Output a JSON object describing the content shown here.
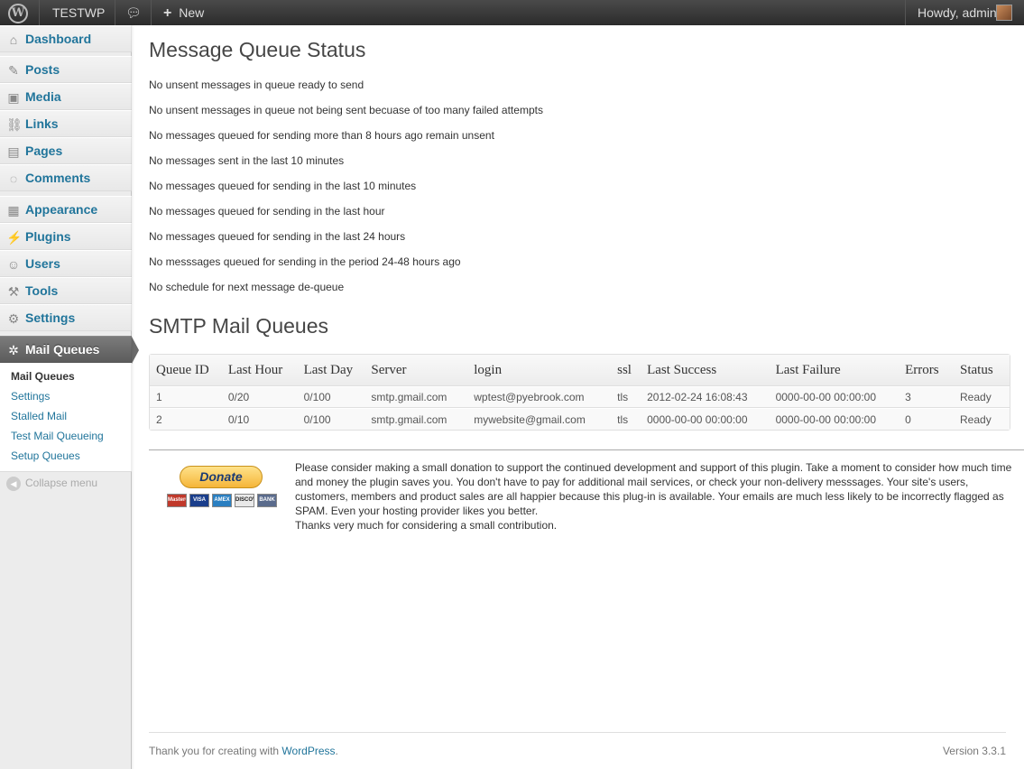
{
  "adminbar": {
    "site_name": "TESTWP",
    "new_label": "New",
    "howdy": "Howdy, admin"
  },
  "sidebar": {
    "items": [
      {
        "label": "Dashboard",
        "icon": "dashboard-icon",
        "glyph": "⌂"
      },
      {
        "label": "Posts",
        "icon": "pushpin-icon",
        "glyph": "✎"
      },
      {
        "label": "Media",
        "icon": "media-icon",
        "glyph": "▣"
      },
      {
        "label": "Links",
        "icon": "link-icon",
        "glyph": "⛓"
      },
      {
        "label": "Pages",
        "icon": "pages-icon",
        "glyph": "▤"
      },
      {
        "label": "Comments",
        "icon": "comment-bubble-icon",
        "glyph": "◌"
      },
      {
        "label": "Appearance",
        "icon": "appearance-icon",
        "glyph": "▦"
      },
      {
        "label": "Plugins",
        "icon": "plug-icon",
        "glyph": "⚡"
      },
      {
        "label": "Users",
        "icon": "users-icon",
        "glyph": "☺"
      },
      {
        "label": "Tools",
        "icon": "tools-icon",
        "glyph": "⚒"
      },
      {
        "label": "Settings",
        "icon": "settings-icon",
        "glyph": "⚙"
      },
      {
        "label": "Mail Queues",
        "icon": "gear-icon",
        "glyph": "✲"
      }
    ],
    "submenu": [
      "Mail Queues",
      "Settings",
      "Stalled Mail",
      "Test Mail Queueing",
      "Setup Queues"
    ],
    "collapse_label": "Collapse menu"
  },
  "main": {
    "status_title": "Message Queue Status",
    "status_lines": [
      "No unsent messages in queue ready to send",
      "No unsent messages in queue not being sent becuase of too many failed attempts",
      "No messages queued for sending more than 8 hours ago remain unsent",
      "No messages sent in the last 10 minutes",
      "No messages queued for sending in the last 10 minutes",
      "No messages queued for sending in the last hour",
      "No messages queued for sending in the last 24 hours",
      "No messsages queued for sending in the period 24-48 hours ago",
      "No schedule for next message de-queue"
    ],
    "queues_title": "SMTP Mail Queues",
    "table": {
      "headers": [
        "Queue ID",
        "Last Hour",
        "Last Day",
        "Server",
        "login",
        "ssl",
        "Last Success",
        "Last Failure",
        "Errors",
        "Status"
      ],
      "rows": [
        [
          "1",
          "0/20",
          "0/100",
          "smtp.gmail.com",
          "wptest@pyebrook.com",
          "tls",
          "2012-02-24 16:08:43",
          "0000-00-00 00:00:00",
          "3",
          "Ready"
        ],
        [
          "2",
          "0/10",
          "0/100",
          "smtp.gmail.com",
          "mywebsite@gmail.com",
          "tls",
          "0000-00-00 00:00:00",
          "0000-00-00 00:00:00",
          "0",
          "Ready"
        ]
      ]
    },
    "donate": {
      "button_label": "Donate",
      "cards": [
        "MasterCard",
        "VISA",
        "AMEX",
        "DISCOVER",
        "BANK"
      ],
      "text_lines": [
        "Please consider making a small donation to support the continued development and support of this plugin. Take a moment to consider how much time and money the plugin saves you. You don't have to pay for additional mail services, or check your non-delivery messsages. Your site's users, customers, members and product sales are all happier because this plug-in is available. Your emails are much less likely to be incorrectly flagged as SPAM. Even your hosting provider likes you better.",
        "Thanks very much for considering a small contribution."
      ]
    }
  },
  "footer": {
    "thanks_prefix": "Thank you for creating with ",
    "thanks_link": "WordPress",
    "thanks_suffix": ".",
    "version": "Version 3.3.1"
  },
  "colors": {
    "link": "#21759b",
    "adminbar_bg": "#333333",
    "current_menu_bg": "#6a6a6a"
  }
}
